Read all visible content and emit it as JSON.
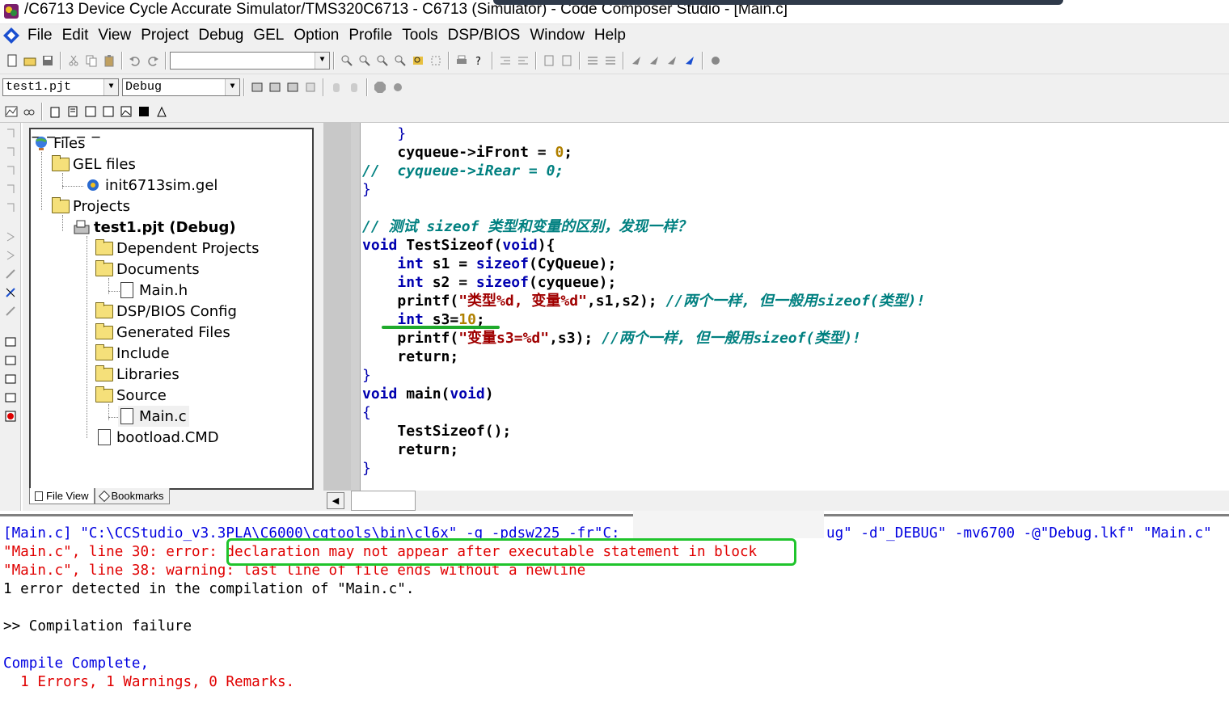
{
  "window": {
    "title": "/C6713 Device Cycle Accurate Simulator/TMS320C6713 - C6713 (Simulator) - Code Composer Studio - [Main.c]"
  },
  "menu": {
    "items": [
      "File",
      "Edit",
      "View",
      "Project",
      "Debug",
      "GEL",
      "Option",
      "Profile",
      "Tools",
      "DSP/BIOS",
      "Window",
      "Help"
    ]
  },
  "toolbar": {
    "project_combo": "test1.pjt",
    "config_combo": "Debug",
    "search_combo": ""
  },
  "project_tree": {
    "root": "Files",
    "gel_files": "GEL files",
    "gel_file": "init6713sim.gel",
    "projects": "Projects",
    "project": "test1.pjt (Debug)",
    "dependent": "Dependent Projects",
    "documents": "Documents",
    "main_h": "Main.h",
    "dspbios": "DSP/BIOS Config",
    "generated": "Generated Files",
    "include": "Include",
    "libraries": "Libraries",
    "source": "Source",
    "main_c": "Main.c",
    "bootload": "bootload.CMD",
    "tab_file_view": "File View",
    "tab_bookmarks": "Bookmarks"
  },
  "code": {
    "l1": "}",
    "l2a": "cyqueue->iFront = ",
    "l2b": "0",
    "l2c": ";",
    "l3": "//  cyqueue->iRear = 0;",
    "l4": "}",
    "l6": "// 测试 sizeof 类型和变量的区别，发现一样？",
    "l7a": "void",
    "l7b": " TestSizeof(",
    "l7c": "void",
    "l7d": "){",
    "l8a": "int",
    "l8b": " s1 = ",
    "l8c": "sizeof",
    "l8d": "(CyQueue);",
    "l9a": "int",
    "l9b": " s2 = ",
    "l9c": "sizeof",
    "l9d": "(cyqueue);",
    "l10a": "printf(",
    "l10b": "\"类型%d, 变量%d\"",
    "l10c": ",s1,s2); ",
    "l10d": "//两个一样, 但一般用sizeof(类型)!",
    "l11a": "int",
    "l11b": " s3=",
    "l11c": "10",
    "l11d": ";",
    "l12a": "printf(",
    "l12b": "\"变量s3=%d\"",
    "l12c": ",s3); ",
    "l12d": "//两个一样, 但一般用sizeof(类型)!",
    "l13": "return;",
    "l14": "}",
    "l15a": "void",
    "l15b": " main(",
    "l15c": "void",
    "l15d": ")",
    "l16": "{",
    "l17": "TestSizeof();",
    "l18": "return;",
    "l19": "}"
  },
  "output": {
    "cmd_a": "[Main.c] \"C:\\CCStudio_v3.3PLA\\C6000\\cgtools\\bin\\cl6x\" -g -pdsw225 -fr\"C:",
    "cmd_b": "ug\" -d\"_DEBUG\" -mv6700 -@\"Debug.lkf\" \"Main.c\"",
    "err1_prefix": "\"Main.c\", line 30: error: ",
    "err1_msg": "declaration may not appear after executable statement in block",
    "warn1": "\"Main.c\", line 38: warning: last line of file ends without a newline",
    "summary": "1 error detected in the compilation of \"Main.c\".",
    "failure": ">> Compilation failure",
    "complete": "Compile Complete,",
    "counts": "  1 Errors, 1 Warnings, 0 Remarks."
  },
  "colors": {
    "keyword": "#0000b0",
    "string": "#a00000",
    "comment": "#008080",
    "number": "#b08000",
    "error": "#e00000",
    "highlight": "#1fc42c"
  }
}
